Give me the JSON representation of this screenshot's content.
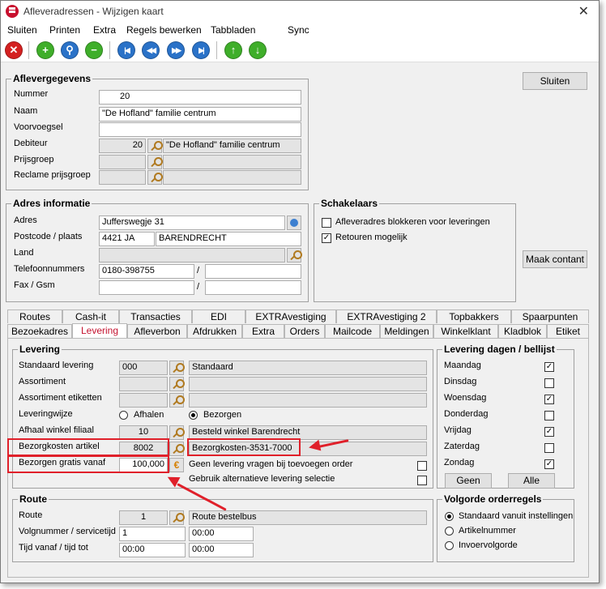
{
  "window": {
    "title": "Afleveradressen - Wijzigen kaart"
  },
  "menu": [
    "Sluiten",
    "Printen",
    "Extra",
    "Regels bewerken",
    "Tabbladen",
    "Sync"
  ],
  "toolbar_icons": [
    "close-red-icon",
    "add-green-icon",
    "search-blue-icon",
    "remove-green-icon",
    "first-icon",
    "previous-icon",
    "next-icon",
    "last-icon",
    "up-icon",
    "down-icon"
  ],
  "side_buttons": {
    "close": "Sluiten",
    "contact": "Maak contant"
  },
  "aflevergegevens": {
    "title": "Aflevergegevens",
    "nummer_label": "Nummer",
    "nummer": "20",
    "naam_label": "Naam",
    "naam": "\"De Hofland\" familie centrum",
    "voorvoegsel_label": "Voorvoegsel",
    "voorvoegsel": "",
    "debiteur_label": "Debiteur",
    "debiteur_code": "20",
    "debiteur_naam": "\"De Hofland\" familie centrum",
    "prijsgroep_label": "Prijsgroep",
    "reclame_label": "Reclame prijsgroep"
  },
  "adres": {
    "title": "Adres informatie",
    "adres_label": "Adres",
    "adres": "Jufferswegje 31",
    "postcode_label": "Postcode / plaats",
    "postcode": "4421 JA",
    "plaats": "BARENDRECHT",
    "land_label": "Land",
    "telefoon_label": "Telefoonnummers",
    "telefoon1": "0180-398755",
    "telefoon2": "",
    "fax_label": "Fax / Gsm",
    "slash": "/"
  },
  "schakelaars": {
    "title": "Schakelaars",
    "items": [
      {
        "label": "Afleveradres blokkeren voor leveringen",
        "checked": false
      },
      {
        "label": "Retouren mogelijk",
        "checked": true
      }
    ]
  },
  "tabs_row1": [
    "Routes",
    "Cash-it",
    "Transacties",
    "EDI",
    "EXTRAvestiging",
    "EXTRAvestiging 2",
    "Topbakkers",
    "Spaarpunten"
  ],
  "tabs_row2": [
    "Bezoekadres",
    "Levering",
    "Afleverbon",
    "Afdrukken",
    "Extra",
    "Orders",
    "Mailcode",
    "Meldingen",
    "Winkelklant",
    "Kladblok",
    "Etiket"
  ],
  "levering": {
    "title": "Levering",
    "standaard_label": "Standaard levering",
    "standaard_code": "000",
    "standaard_naam": "Standaard",
    "assortiment_label": "Assortiment",
    "assortiment_etiketten_label": "Assortiment etiketten",
    "leveringwijze_label": "Leveringwijze",
    "afhalen": "Afhalen",
    "bezorgen": "Bezorgen",
    "afhaal_label": "Afhaal winkel filiaal",
    "afhaal_code": "10",
    "afhaal_naam": "Besteld winkel Barendrecht",
    "bezorgkosten_label": "Bezorgkosten artikel",
    "bezorgkosten_code": "8002",
    "bezorgkosten_naam": "Bezorgkosten-3531-7000",
    "gratis_label": "Bezorgen gratis vanaf",
    "gratis_value": "100,000",
    "geen_levering_label": "Geen levering vragen bij toevoegen order",
    "alternatief_label": "Gebruik alternatieve levering selectie"
  },
  "dagen": {
    "title": "Levering dagen / bellijst",
    "days": [
      {
        "label": "Maandag",
        "checked": true
      },
      {
        "label": "Dinsdag",
        "checked": false
      },
      {
        "label": "Woensdag",
        "checked": true
      },
      {
        "label": "Donderdag",
        "checked": false
      },
      {
        "label": "Vrijdag",
        "checked": true
      },
      {
        "label": "Zaterdag",
        "checked": false
      },
      {
        "label": "Zondag",
        "checked": true
      }
    ],
    "geen": "Geen",
    "alle": "Alle"
  },
  "route": {
    "title": "Route",
    "route_label": "Route",
    "route_code": "1",
    "route_naam": "Route bestelbus",
    "volgnummer_label": "Volgnummer / servicetijd",
    "volgnummer": "1",
    "servicetijd": "00:00",
    "tijd_label": "Tijd vanaf / tijd tot",
    "tijd_vanaf": "00:00",
    "tijd_tot": "00:00"
  },
  "volgorde": {
    "title": "Volgorde orderregels",
    "options": [
      "Standaard vanuit instellingen",
      "Artikelnummer",
      "Invoervolgorde"
    ]
  },
  "check_mark": "✓",
  "accent_colors": {
    "annotation": "#e0202a",
    "active_tab": "#c4122f"
  }
}
